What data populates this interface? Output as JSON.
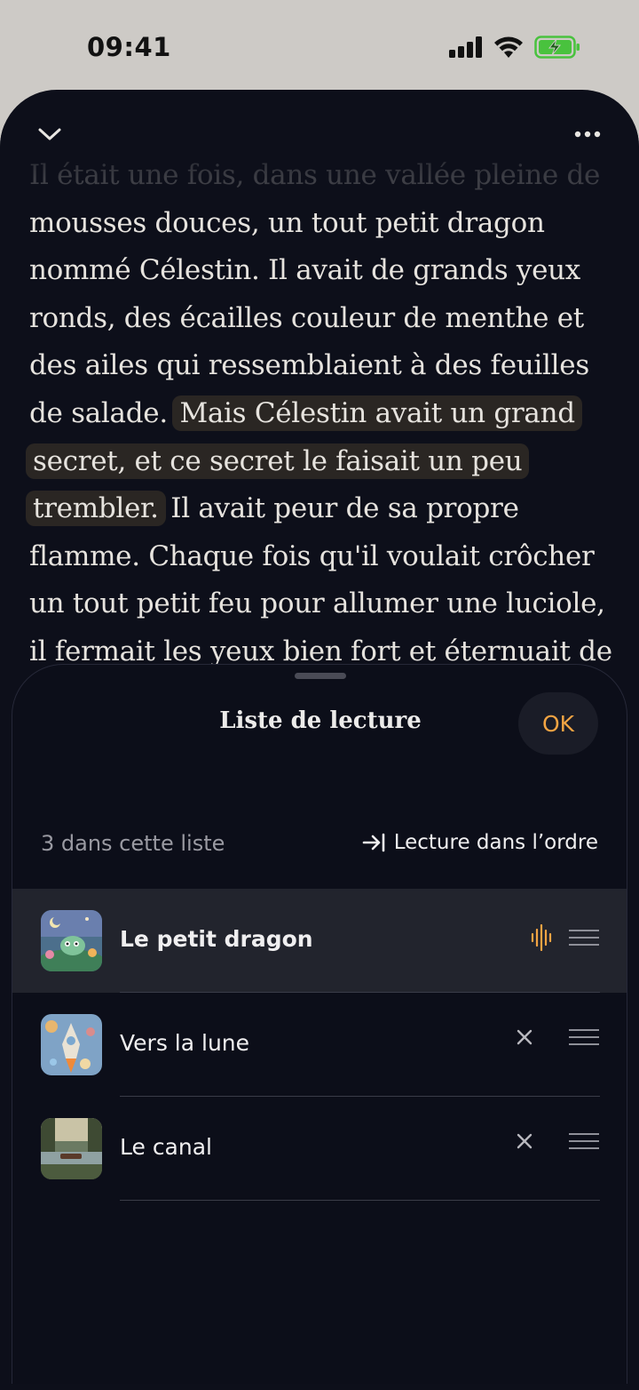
{
  "status_bar": {
    "time": "09:41"
  },
  "reader": {
    "faded_line": "Il était une fois, dans une vallée pleine de",
    "text_before": "mousses douces, un tout petit dragon nommé Célestin. Il avait de grands yeux ronds, des écailles couleur de menthe et des ailes qui ressemblaient à des feuilles de salade. ",
    "highlighted": "Mais Célestin avait un grand secret, et ce secret le faisait un peu trembler.",
    "text_after": " Il avait peur de sa propre flamme. Chaque fois qu'il voulait crôcher un tout petit feu pour allumer une luciole, il fermait les yeux bien fort et éternuait de travers par peur de se"
  },
  "sheet": {
    "title": "Liste de lecture",
    "ok_label": "OK",
    "count_label": "3 dans cette liste",
    "order_label": "Lecture dans l’ordre",
    "items": [
      {
        "title": "Le petit dragon",
        "active": true
      },
      {
        "title": "Vers la lune",
        "active": false
      },
      {
        "title": "Le canal",
        "active": false
      }
    ]
  },
  "colors": {
    "accent": "#f2a443",
    "background": "#0d0f1a",
    "highlight": "#2a2623",
    "active_row": "#22242d"
  },
  "icons": {
    "chevron": "chevron-down-icon",
    "more": "more-icon",
    "order": "arrow-to-line-icon",
    "playing": "waveform-icon",
    "drag": "drag-handle-icon",
    "remove": "close-icon"
  }
}
